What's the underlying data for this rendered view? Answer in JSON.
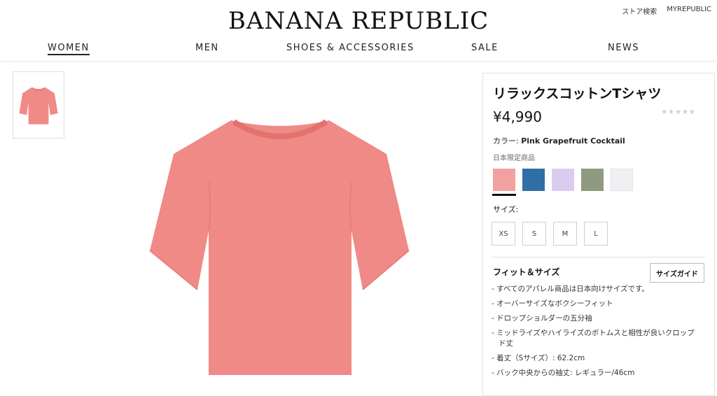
{
  "header": {
    "logo": "BANANA REPUBLIC",
    "util_links": [
      "ストア検索",
      "MYREPUBLIC"
    ],
    "nav": [
      "WOMEN",
      "MEN",
      "SHOES & ACCESSORIES",
      "SALE",
      "NEWS"
    ]
  },
  "gallery": {
    "thumbnail_icon": "t-shirt-thumbnail",
    "main_icon": "t-shirt-image",
    "shirt_color": "#f08a86"
  },
  "product": {
    "title": "リラックスコットンTシャツ",
    "price": "¥4,990",
    "stars": "★★★★★",
    "color_label": "カラー:",
    "color_value": "Pink Grapefruit Cocktail",
    "exclusive": "日本限定商品",
    "swatches": [
      "#f2a0a2",
      "#2f6fa6",
      "#dccbf0",
      "#8e9b80",
      "#eef0f3"
    ],
    "size_label": "サイズ:",
    "sizes": [
      "XS",
      "S",
      "M",
      "L"
    ],
    "fit_title": "フィット＆サイズ",
    "size_guide_label": "サイズガイド",
    "bullets": [
      "- すべてのアパレル商品は日本向けサイズです。",
      "- オーバーサイズなボクシーフィット",
      "- ドロップショルダーの五分袖",
      "- ミッドライズやハイライズのボトムスと相性が良いクロップド丈",
      "- 着丈（Sサイズ）: 62.2cm",
      "- バック中央からの袖丈: レギュラー/46cm"
    ]
  }
}
